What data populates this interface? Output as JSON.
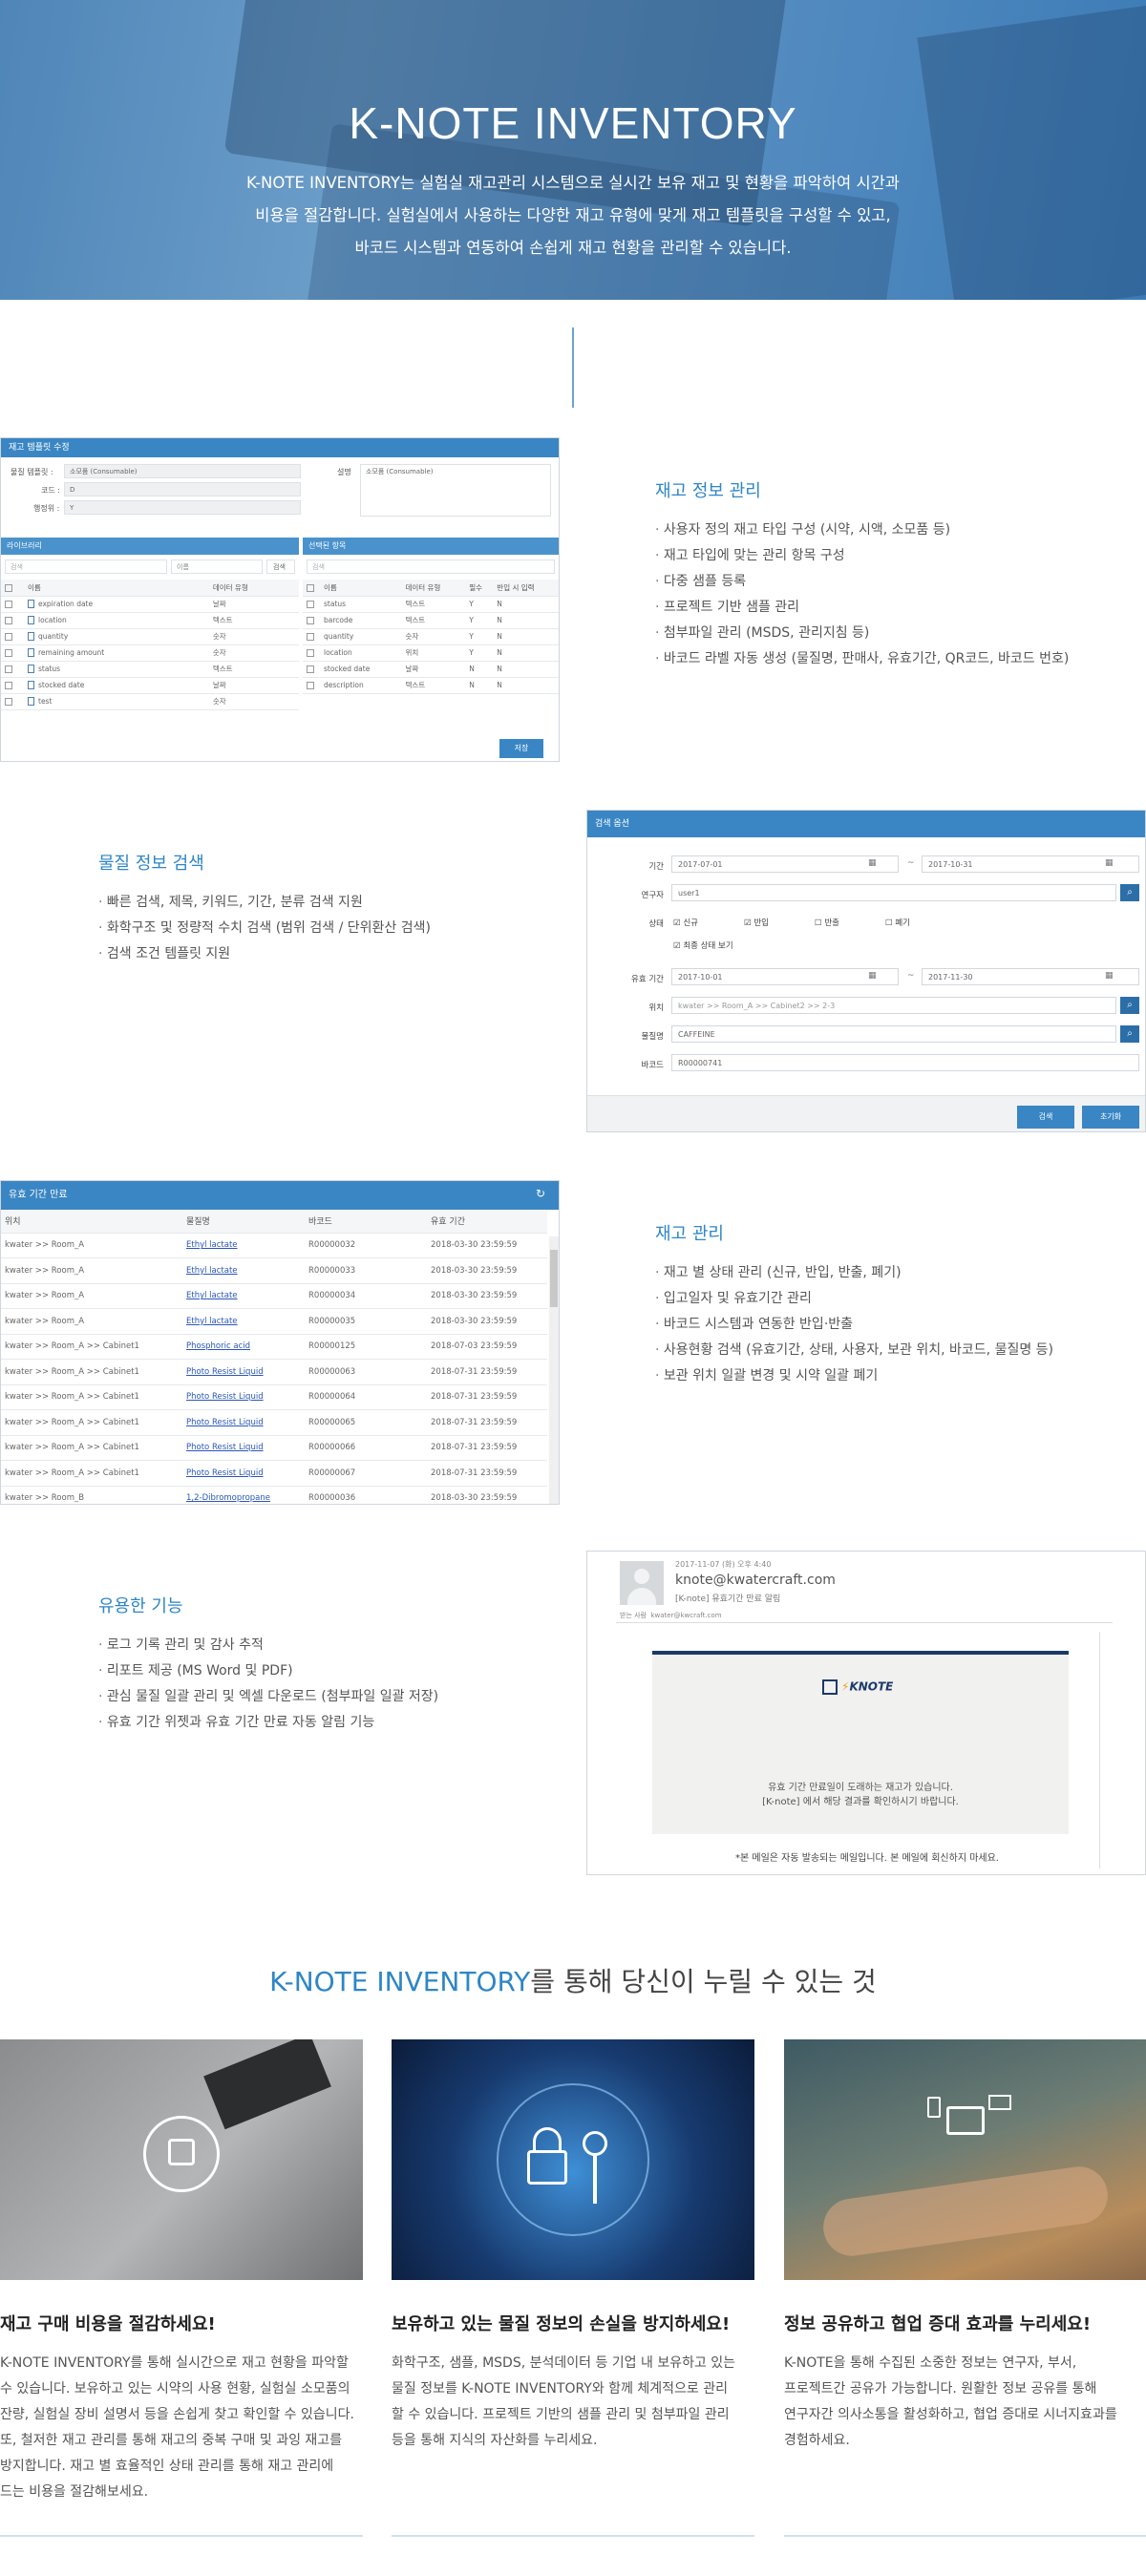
{
  "hero": {
    "title": "K-NOTE INVENTORY",
    "lines": [
      "K-NOTE INVENTORY는 실험실 재고관리 시스템으로 실시간 보유 재고 및 현황을 파악하여 시간과",
      "비용을 절감합니다. 실험실에서 사용하는 다양한 재고 유형에 맞게 재고 템플릿을 구성할 수 있고,",
      "바코드 시스템과 연동하여 손쉽게 재고 현황을 관리할 수 있습니다."
    ]
  },
  "features": [
    {
      "title": "재고 정보 관리",
      "items": [
        "사용자 정의 재고 타입 구성 (시약, 시액, 소모품 등)",
        "재고 타입에 맞는 관리 항목 구성",
        "다중 샘플 등록",
        "프로젝트 기반 샘플 관리",
        "첨부파일 관리 (MSDS, 관리지침 등)",
        "바코드 라벨 자동 생성 (물질명, 판매사, 유효기간, QR코드, 바코드 번호)"
      ]
    },
    {
      "title": "물질 정보 검색",
      "items": [
        "빠른 검색, 제목, 키워드, 기간, 분류 검색 지원",
        "화학구조 및 정량적 수치 검색 (범위 검색 / 단위환산 검색)",
        "검색 조건 템플릿 지원"
      ]
    },
    {
      "title": "재고 관리",
      "items": [
        "재고 별 상태 관리 (신규, 반입, 반출, 폐기)",
        "입고일자 및 유효기간 관리",
        "바코드 시스템과 연동한 반입·반출",
        "사용현황 검색 (유효기간, 상태, 사용자, 보관 위치, 바코드, 물질명 등)",
        "보관 위치 일괄 변경 및 시약 일괄 폐기"
      ]
    },
    {
      "title": "유용한 기능",
      "items": [
        "로그 기록 관리 및 감사 추적",
        "리포트 제공 (MS Word 및 PDF)",
        "관심 물질 일괄 관리 및 엑셀 다운로드 (첨부파일 일괄 저장)",
        "유효 기간 위젯과 유효 기간 만료 자동 알림 기능"
      ]
    }
  ],
  "panel1": {
    "title": "재고 템플릿 수정",
    "template_label": "물질 템플릿 :",
    "template_value": "소모품 (Consumable)",
    "code_label": "코드 :",
    "code_value": "D",
    "row_label": "행정위 :",
    "row_value": "Y",
    "desc_label": "설명",
    "desc_value": "소모품 (Consumable)",
    "library_title": "라이브러리",
    "selected_title": "선택된 항목",
    "search_ph": "검색",
    "name_ph": "이름",
    "search_btn": "검색",
    "left_cols": [
      "이름",
      "데이터 유형"
    ],
    "left_rows": [
      [
        "expiration date",
        "날짜"
      ],
      [
        "location",
        "텍스트"
      ],
      [
        "quantity",
        "숫자"
      ],
      [
        "remaining amount",
        "숫자"
      ],
      [
        "status",
        "텍스트"
      ],
      [
        "stocked date",
        "날짜"
      ],
      [
        "test",
        "숫자"
      ]
    ],
    "right_cols": [
      "이름",
      "데이터 유형",
      "필수",
      "반입 시 입력"
    ],
    "right_rows": [
      [
        "status",
        "텍스트",
        "Y",
        "N"
      ],
      [
        "barcode",
        "텍스트",
        "Y",
        "N"
      ],
      [
        "quantity",
        "숫자",
        "Y",
        "N"
      ],
      [
        "location",
        "위치",
        "Y",
        "N"
      ],
      [
        "stocked date",
        "날짜",
        "N",
        "N"
      ],
      [
        "description",
        "텍스트",
        "N",
        "N"
      ]
    ],
    "save_btn": "저장"
  },
  "panel2": {
    "title": "검색 옵션",
    "period_label": "기간",
    "period_from": "2017-07-01",
    "period_to": "2017-10-31",
    "user_label": "연구자",
    "user_value": "user1",
    "status_label": "상태",
    "statuses": [
      "신규",
      "반입",
      "반출",
      "폐기"
    ],
    "latest_label": "최종 상태 보기",
    "expiry_label": "유효 기간",
    "expiry_from": "2017-10-01",
    "expiry_to": "2017-11-30",
    "loc_label": "위치",
    "loc_value": "kwater >> Room_A >> Cabinet2 >> 2-3",
    "name_label": "물질명",
    "name_value": "CAFFEINE",
    "barcode_label": "바코드",
    "barcode_value": "R00000741",
    "search_btn": "검색",
    "reset_btn": "초기화"
  },
  "panel3": {
    "title": "유효 기간 만료",
    "cols": [
      "위치",
      "물질명",
      "바코드",
      "유효 기간"
    ],
    "rows": [
      [
        "kwater >> Room_A",
        "Ethyl lactate",
        "R00000032",
        "2018-03-30 23:59:59"
      ],
      [
        "kwater >> Room_A",
        "Ethyl lactate",
        "R00000033",
        "2018-03-30 23:59:59"
      ],
      [
        "kwater >> Room_A",
        "Ethyl lactate",
        "R00000034",
        "2018-03-30 23:59:59"
      ],
      [
        "kwater >> Room_A",
        "Ethyl lactate",
        "R00000035",
        "2018-03-30 23:59:59"
      ],
      [
        "kwater >> Room_A >> Cabinet1",
        "Phosphoric acid",
        "R00000125",
        "2018-07-03 23:59:59"
      ],
      [
        "kwater >> Room_A >> Cabinet1",
        "Photo Resist Liquid",
        "R00000063",
        "2018-07-31 23:59:59"
      ],
      [
        "kwater >> Room_A >> Cabinet1",
        "Photo Resist Liquid",
        "R00000064",
        "2018-07-31 23:59:59"
      ],
      [
        "kwater >> Room_A >> Cabinet1",
        "Photo Resist Liquid",
        "R00000065",
        "2018-07-31 23:59:59"
      ],
      [
        "kwater >> Room_A >> Cabinet1",
        "Photo Resist Liquid",
        "R00000066",
        "2018-07-31 23:59:59"
      ],
      [
        "kwater >> Room_A >> Cabinet1",
        "Photo Resist Liquid",
        "R00000067",
        "2018-07-31 23:59:59"
      ],
      [
        "kwater >> Room_B",
        "1,2-Dibromopropane",
        "R00000036",
        "2018-03-30 23:59:59"
      ]
    ]
  },
  "panel4": {
    "date": "2017-11-07 (화) 오후 4:40",
    "sender": "knote@kwatercraft.com",
    "subject": "[K-note] 유효기간 만료 알림",
    "to_label": "받는 사람",
    "to_value": "kwater@kwcraft.com",
    "logo": "KNOTE",
    "msg1": "유효 기간 만료일이 도래하는 재고가 있습니다.",
    "msg2": "[K-note] 에서 해당 결과를 확인하시기 바랍니다.",
    "footer": "*본 메일은 자동 발송되는 메일입니다. 본 메일에 회신하지 마세요."
  },
  "section2": {
    "title_accent": "K-NOTE INVENTORY",
    "title_rest": "를 통해 당신이 누릴 수 있는 것",
    "cards": [
      {
        "title": "재고 구매 비용을 절감하세요!",
        "lines": [
          "K-NOTE INVENTORY를 통해 실시간으로 재고 현황을 파악할",
          "수 있습니다. 보유하고 있는 시약의 사용 현황, 실험실 소모품의",
          "잔량, 실험실 장비 설명서 등을 손쉽게 찾고 확인할 수 있습니다.",
          "또, 철저한 재고 관리를 통해 재고의 중복 구매 및 과잉 재고를",
          "방지합니다. 재고 별 효율적인 상태 관리를 통해 재고 관리에",
          "드는 비용을 절감해보세요."
        ]
      },
      {
        "title": "보유하고 있는 물질 정보의 손실을 방지하세요!",
        "lines": [
          "화학구조, 샘플, MSDS, 분석데이터 등 기업 내 보유하고 있는",
          "물질 정보를 K-NOTE INVENTORY와 함께 체계적으로 관리",
          "할 수 있습니다. 프로젝트 기반의 샘플 관리 및 첨부파일 관리",
          "등을 통해 지식의 자산화를 누리세요."
        ]
      },
      {
        "title": "정보 공유하고 협업 증대 효과를 누리세요!",
        "lines": [
          "K-NOTE을 통해 수집된 소중한 정보는 연구자, 부서,",
          "프로젝트간 공유가 가능합니다. 원활한 정보 공유를 통해",
          "연구자간 의사소통을 활성화하고, 협업 증대로 시너지효과를",
          "경험하세요."
        ]
      }
    ]
  }
}
